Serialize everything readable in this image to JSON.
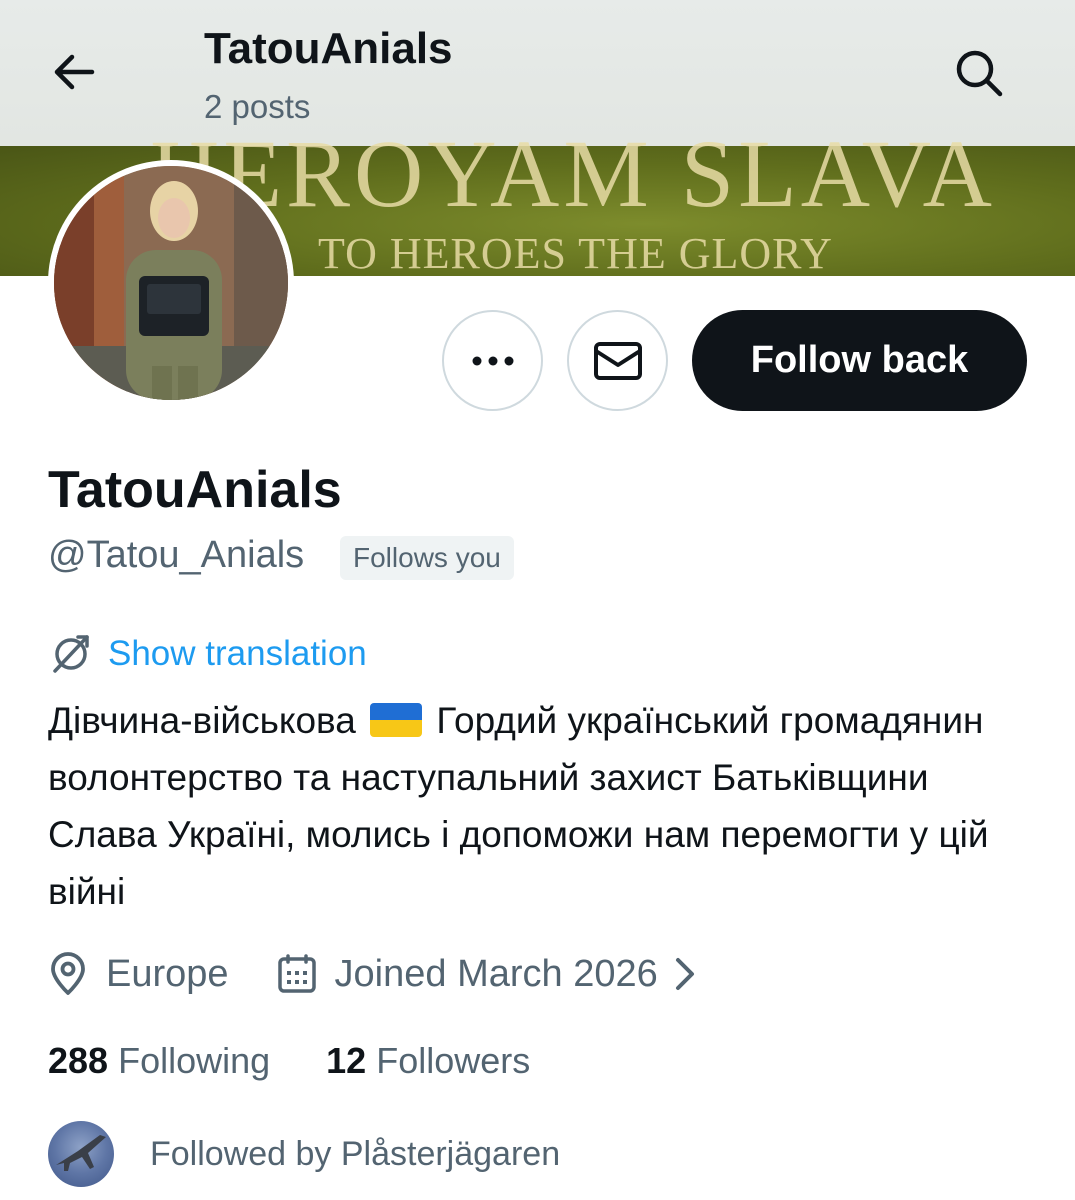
{
  "header": {
    "title": "TatouAnials",
    "posts_count": "2 posts"
  },
  "banner": {
    "headline": "HEROYAM SLAVA",
    "subline": "TO HEROES THE GLORY"
  },
  "actions": {
    "more_icon": "more-horizontal-icon",
    "dm_icon": "envelope-icon",
    "follow_label": "Follow back"
  },
  "profile": {
    "display_name": "TatouAnials",
    "handle": "@Tatou_Anials",
    "follows_you": "Follows you",
    "translation_label": "Show translation",
    "bio_part1": "Дівчина-військова",
    "bio_part2": " Гордий український громадянин волонтерство та наступальний захист Батьківщини Слава Україні, молись і допоможи нам перемогти у цій війні",
    "location": "Europe",
    "joined": "Joined March 2026"
  },
  "stats": {
    "following_count": "288",
    "following_label": "Following",
    "followers_count": "12",
    "followers_label": "Followers"
  },
  "followed_by": {
    "text": "Followed by Plåsterjägaren"
  },
  "colors": {
    "text_primary": "#0f1419",
    "text_secondary": "#536471",
    "link_blue": "#1d9bf0",
    "button_dark": "#0f1419",
    "border": "#cfd9de",
    "flag_blue": "#1f6ed4",
    "flag_yellow": "#f7c717"
  }
}
